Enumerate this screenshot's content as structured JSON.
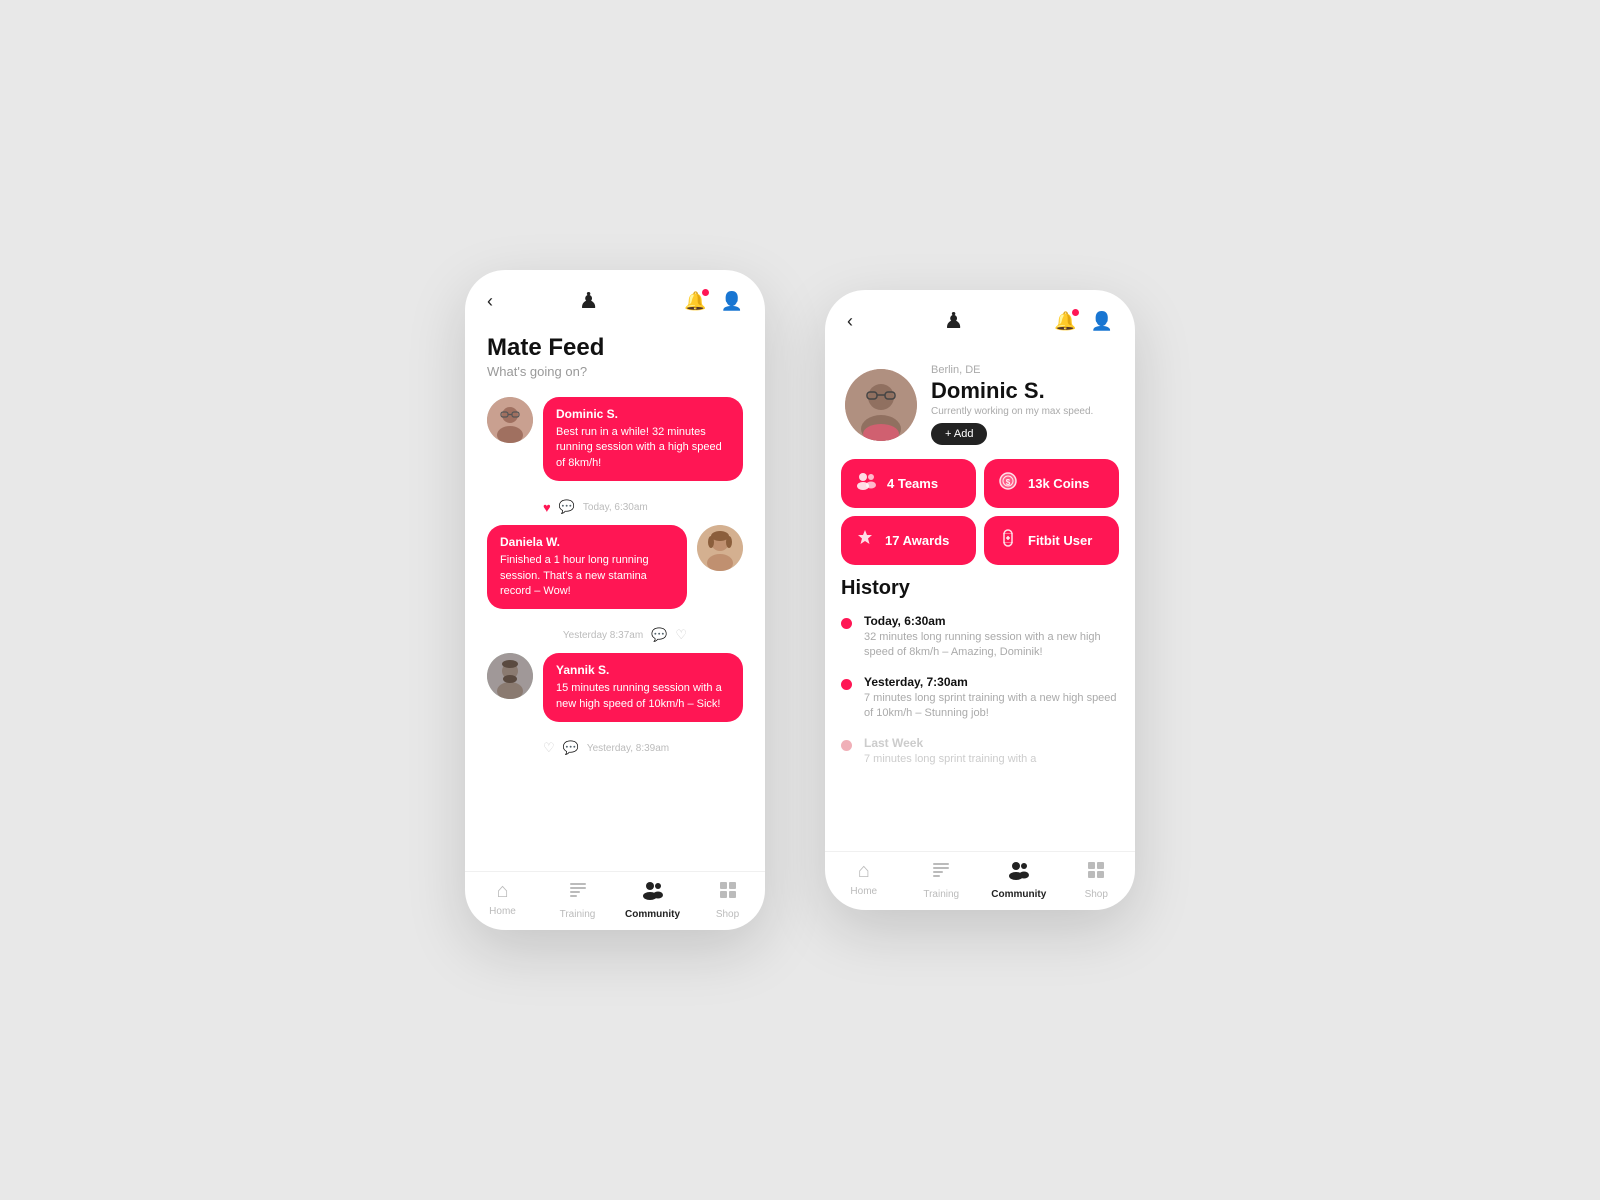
{
  "app": {
    "accent": "#ff1654",
    "dark": "#222222"
  },
  "left_phone": {
    "header": {
      "logo": "♟",
      "back": "‹"
    },
    "title": "Mate Feed",
    "subtitle": "What's going on?",
    "feed": [
      {
        "id": "dominic",
        "name": "Dominic S.",
        "text": "Best run in a while! 32 minutes running session with a high speed of 8km/h!",
        "time": "Today, 6:30am",
        "align": "left",
        "liked": true
      },
      {
        "id": "daniela",
        "name": "Daniela W.",
        "text": "Finished a 1 hour long running session. That's a new stamina record – Wow!",
        "time": "Yesterday 8:37am",
        "align": "right",
        "liked": false
      },
      {
        "id": "yannik",
        "name": "Yannik S.",
        "text": "15 minutes running session with a new high speed of 10km/h – Sick!",
        "time": "Yesterday, 8:39am",
        "align": "left",
        "liked": false
      }
    ],
    "nav": [
      {
        "label": "Home",
        "icon": "⌂",
        "active": false
      },
      {
        "label": "Training",
        "icon": "☰",
        "active": false
      },
      {
        "label": "Community",
        "icon": "👥",
        "active": true
      },
      {
        "label": "Shop",
        "icon": "⊞",
        "active": false
      }
    ]
  },
  "right_phone": {
    "header": {
      "back": "‹",
      "logo": "♟"
    },
    "profile": {
      "location": "Berlin, DE",
      "name": "Dominic S.",
      "bio": "Currently working on my max speed.",
      "add_label": "+ Add"
    },
    "stats": [
      {
        "icon": "👥",
        "label": "4 Teams"
      },
      {
        "icon": "🪙",
        "label": "13k Coins"
      },
      {
        "icon": "🏆",
        "label": "17 Awards"
      },
      {
        "icon": "⌚",
        "label": "Fitbit User"
      }
    ],
    "history_title": "History",
    "history": [
      {
        "time": "Today, 6:30am",
        "desc": "32 minutes long running session with a new high speed of 8km/h – Amazing, Dominik!",
        "faded": false
      },
      {
        "time": "Yesterday, 7:30am",
        "desc": "7 minutes long sprint training with a new high speed of 10km/h – Stunning job!",
        "faded": false
      },
      {
        "time": "Last Week",
        "desc": "7 minutes long sprint training with a",
        "faded": true
      }
    ],
    "nav": [
      {
        "label": "Home",
        "icon": "⌂",
        "active": false
      },
      {
        "label": "Training",
        "icon": "☰",
        "active": false
      },
      {
        "label": "Community",
        "icon": "👥",
        "active": true
      },
      {
        "label": "Shop",
        "icon": "⊞",
        "active": false
      }
    ]
  }
}
